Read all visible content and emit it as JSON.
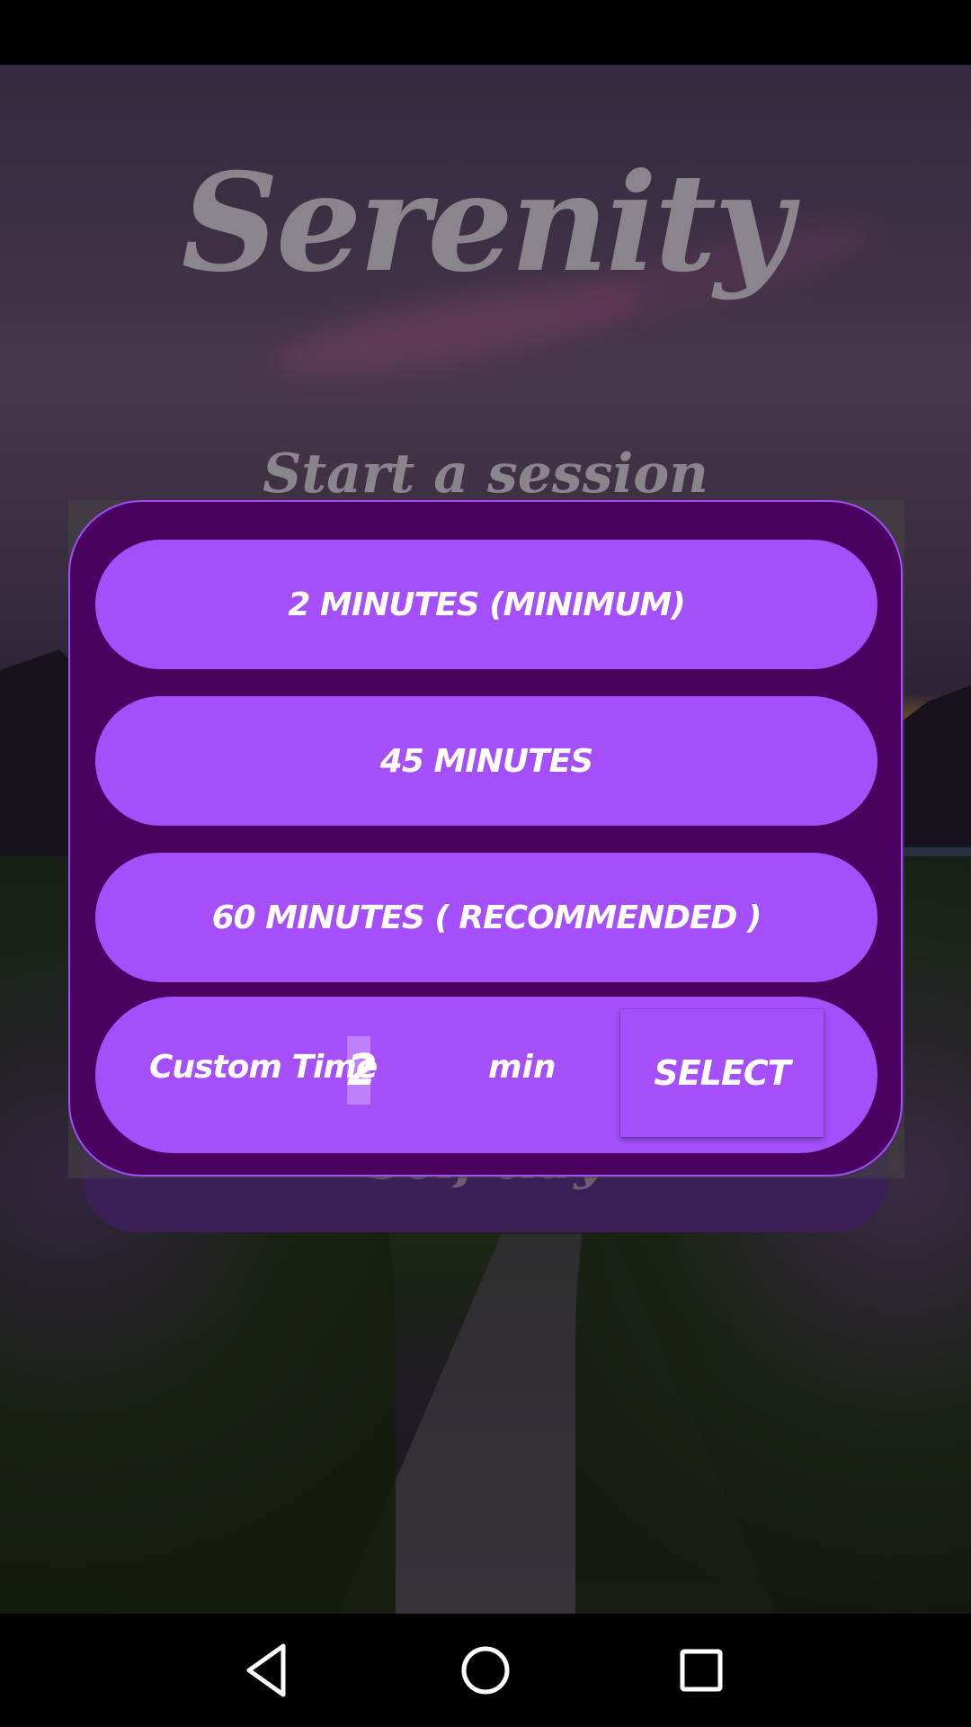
{
  "app": {
    "title": "Serenity",
    "subtitle": "Start a session",
    "back_card_label": "Self-tidy"
  },
  "dialog": {
    "options": [
      {
        "label": "2 MINUTES (MINIMUM)"
      },
      {
        "label": "45 MINUTES"
      },
      {
        "label": "60 MINUTES ( RECOMMENDED )"
      }
    ],
    "custom": {
      "label": "Custom Time",
      "value": "2",
      "unit": "min",
      "select_label": "SELECT"
    }
  },
  "nav": {
    "back": "back-icon",
    "home": "home-icon",
    "recents": "recents-icon"
  },
  "colors": {
    "dialog_bg": "#4b015f",
    "button_bg": "#a54ffc",
    "dialog_border": "#a24dff"
  }
}
